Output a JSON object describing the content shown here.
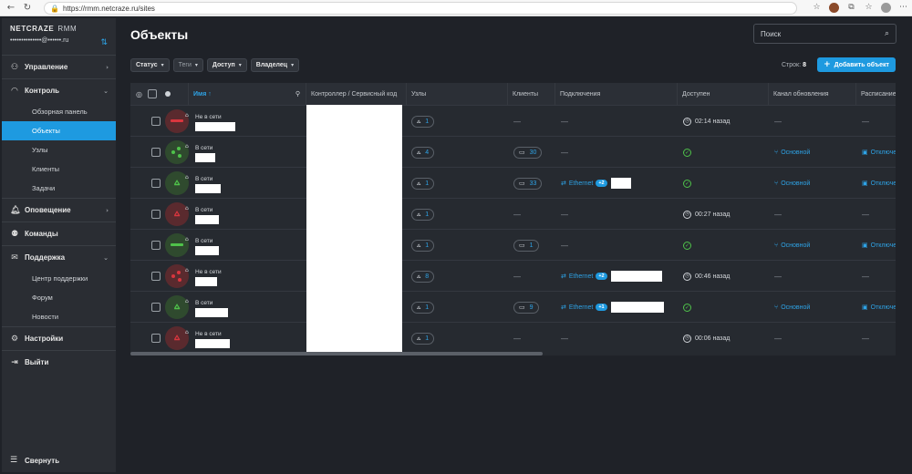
{
  "browser": {
    "url": "https://rmm.netcraze.ru/sites"
  },
  "brand": {
    "name": "NETCRAZE",
    "product": "RMM",
    "user": "••••••••••••••@••••••.ru"
  },
  "sidebar": {
    "items": [
      {
        "label": "Управление"
      },
      {
        "label": "Контроль"
      },
      {
        "label": "Оповещение"
      },
      {
        "label": "Команды"
      },
      {
        "label": "Поддержка"
      },
      {
        "label": "Настройки"
      },
      {
        "label": "Выйти"
      }
    ],
    "control_sub": [
      "Обзорная панель",
      "Объекты",
      "Узлы",
      "Клиенты",
      "Задачи"
    ],
    "support_sub": [
      "Центр поддержки",
      "Форум",
      "Новости"
    ],
    "collapse_label": "Свернуть"
  },
  "header": {
    "title": "Объекты",
    "search_placeholder": "Поиск"
  },
  "filters": [
    {
      "label": "Статус"
    },
    {
      "label": "Теги"
    },
    {
      "label": "Доступ"
    },
    {
      "label": "Владелец"
    }
  ],
  "toolbar": {
    "rows_label": "Строк:",
    "rows_count": "8",
    "add_label": "Добавить объект"
  },
  "table": {
    "columns": [
      "Имя ↑",
      "Контроллер / Сервисный код",
      "Узлы",
      "Клиенты",
      "Подключения",
      "Доступен",
      "Канал обновления",
      "Расписание"
    ],
    "rows": [
      {
        "status": "Не в сети",
        "avatar": "red-dash",
        "nodes": "1",
        "clients": "—",
        "conn": "—",
        "conn_badge": "",
        "available": "02:14 назад",
        "channel": "—",
        "schedule": "—"
      },
      {
        "status": "В сети",
        "avatar": "green-dots",
        "nodes": "4",
        "clients": "30",
        "conn": "—",
        "conn_badge": "",
        "available": "ok",
        "channel": "Основной",
        "schedule": "Отключено"
      },
      {
        "status": "В сети",
        "avatar": "green-bars",
        "nodes": "1",
        "clients": "33",
        "conn": "Ethernet",
        "conn_badge": "+2",
        "available": "ok",
        "channel": "Основной",
        "schedule": "Отключено"
      },
      {
        "status": "В сети",
        "avatar": "red-bars",
        "nodes": "1",
        "clients": "—",
        "conn": "—",
        "conn_badge": "",
        "available": "00:27 назад",
        "channel": "—",
        "schedule": "—"
      },
      {
        "status": "В сети",
        "avatar": "green-dash",
        "nodes": "1",
        "clients": "1",
        "conn": "—",
        "conn_badge": "",
        "available": "ok",
        "channel": "Основной",
        "schedule": "Отключено"
      },
      {
        "status": "Не в сети",
        "avatar": "red-dots",
        "nodes": "8",
        "clients": "—",
        "conn": "Ethernet",
        "conn_badge": "+2",
        "available": "00:46 назад",
        "channel": "—",
        "schedule": "—"
      },
      {
        "status": "В сети",
        "avatar": "green-bars",
        "nodes": "1",
        "clients": "9",
        "conn": "Ethernet",
        "conn_badge": "+1",
        "available": "ok",
        "channel": "Основной",
        "schedule": "Отключено"
      },
      {
        "status": "Не в сети",
        "avatar": "red-bars",
        "nodes": "1",
        "clients": "—",
        "conn": "—",
        "conn_badge": "",
        "available": "00:06 назад",
        "channel": "—",
        "schedule": "—"
      }
    ]
  },
  "colors": {
    "accent": "#1e9ae0",
    "online_green": "#4fc24a",
    "offline_red": "#d9363e",
    "background": "#1f2228",
    "sidebar": "#2a2d33"
  }
}
